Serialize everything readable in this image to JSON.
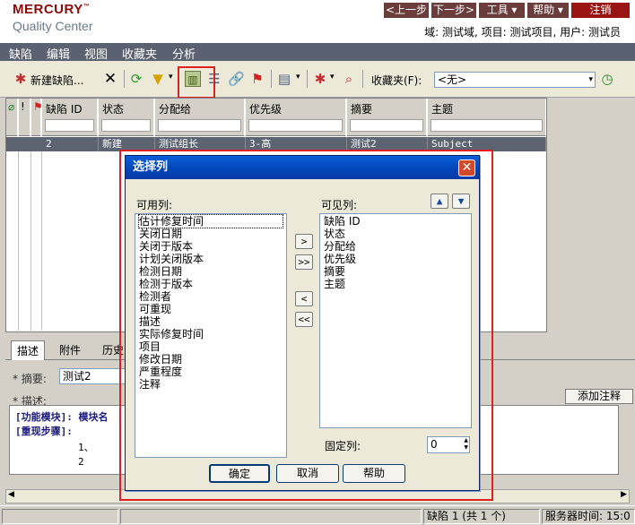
{
  "app": {
    "brand": "MERCURY",
    "trademark": "™",
    "product": "Quality Center",
    "brand_color": "#8b0a0a"
  },
  "nav": {
    "prev": "<上一步",
    "next": "下一步>",
    "tools": "工具 ▾",
    "help": "帮助 ▾",
    "logout": "注销"
  },
  "context": "域: 测试域, 项目: 测试项目, 用户: 测试员",
  "menu": [
    "缺陷",
    "编辑",
    "视图",
    "收藏夹",
    "分析"
  ],
  "toolbar": {
    "new_defect": "新建缺陷...",
    "favorites_label": "收藏夹(F):",
    "favorites_value": "<无>"
  },
  "grid": {
    "columns": [
      "缺陷 ID",
      "状态",
      "分配给",
      "优先级",
      "摘要",
      "主题"
    ],
    "rows": [
      [
        "2",
        "新建",
        "测试组长",
        "3-高",
        "测试2",
        "Subject"
      ]
    ]
  },
  "details": {
    "tabs": [
      "描述",
      "附件",
      "历史"
    ],
    "summary_label": "* 摘要:",
    "summary_value": "测试2",
    "desc_label": "* 描述:",
    "add_comment": "添加注释",
    "desc_lines": [
      "[功能模块]: 模块名",
      "[重现步骤]:",
      "1、",
      "2"
    ]
  },
  "dialog": {
    "title": "选择列",
    "available_label": "可用列:",
    "visible_label": "可见列:",
    "available": [
      "估计修复时间",
      "关闭日期",
      "关闭于版本",
      "计划关闭版本",
      "检测日期",
      "检测于版本",
      "检测者",
      "可重现",
      "描述",
      "实际修复时间",
      "项目",
      "修改日期",
      "严重程度",
      "注释"
    ],
    "visible": [
      "缺陷 ID",
      "状态",
      "分配给",
      "优先级",
      "摘要",
      "主题"
    ],
    "fixed_label": "固定列:",
    "fixed_value": "0",
    "ok": "确定",
    "cancel": "取消",
    "help": "帮助",
    "move_right": ">",
    "move_all_right": ">>",
    "move_left": "<",
    "move_all_left": "<<"
  },
  "status": {
    "count": "缺陷 1 (共 1 个)",
    "server_time": "服务器时间: 15:0"
  }
}
